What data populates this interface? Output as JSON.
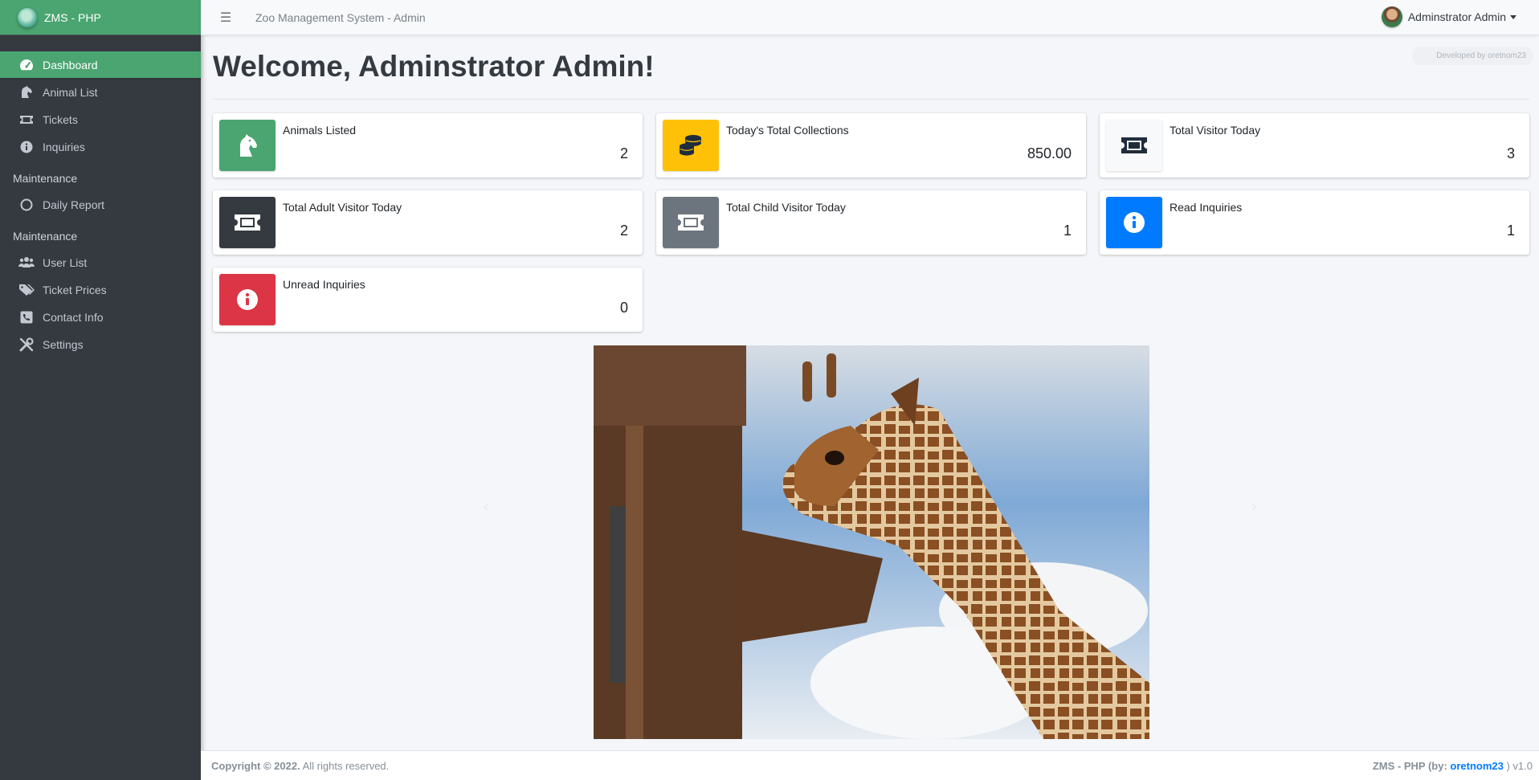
{
  "brand": {
    "name": "ZMS - PHP"
  },
  "sidebar": {
    "items": [
      {
        "label": "Dashboard",
        "icon": "tachometer-icon"
      },
      {
        "label": "Animal List",
        "icon": "horse-icon"
      },
      {
        "label": "Tickets",
        "icon": "ticket-icon"
      },
      {
        "label": "Inquiries",
        "icon": "info-circle-icon"
      }
    ],
    "section1": "Maintenance",
    "section1_items": [
      {
        "label": "Daily Report",
        "icon": "circle-icon"
      }
    ],
    "section2": "Maintenance",
    "section2_items": [
      {
        "label": "User List",
        "icon": "users-icon"
      },
      {
        "label": "Ticket Prices",
        "icon": "tags-icon"
      },
      {
        "label": "Contact Info",
        "icon": "phone-square-icon"
      },
      {
        "label": "Settings",
        "icon": "tools-icon"
      }
    ]
  },
  "topbar": {
    "title": "Zoo Management System - Admin",
    "user": "Adminstrator Admin",
    "dev_badge": "Developed by oretnom23"
  },
  "main": {
    "title": "Welcome, Adminstrator Admin!",
    "cards": [
      {
        "label": "Animals Listed",
        "value": "2",
        "color": "#4aa571",
        "icon": "horse-head-icon"
      },
      {
        "label": "Today's Total Collections",
        "value": "850.00",
        "color": "#ffc107",
        "icon": "coins-icon"
      },
      {
        "label": "Total Visitor Today",
        "value": "3",
        "color": "#f8f9fa",
        "icon": "ticket-icon"
      },
      {
        "label": "Total Adult Visitor Today",
        "value": "2",
        "color": "#343a40",
        "icon": "ticket-icon"
      },
      {
        "label": "Total Child Visitor Today",
        "value": "1",
        "color": "#6c757d",
        "icon": "ticket-icon"
      },
      {
        "label": "Read Inquiries",
        "value": "1",
        "color": "#007bff",
        "icon": "info-circle-icon"
      },
      {
        "label": "Unread Inquiries",
        "value": "0",
        "color": "#dc3545",
        "icon": "info-circle-icon"
      }
    ]
  },
  "footer": {
    "copyright": "Copyright © 2022.",
    "rights": "All rights reserved.",
    "credit_prefix": "ZMS - PHP (by: ",
    "credit_link": "oretnom23",
    "credit_suffix": " ) v1.0"
  }
}
